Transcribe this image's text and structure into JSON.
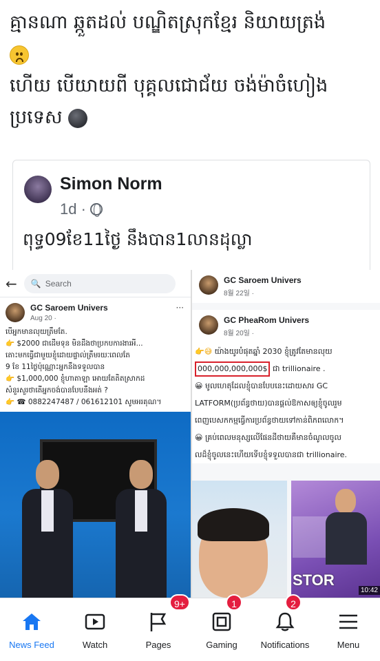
{
  "post": {
    "line1": "គ្មានណា ឆ្កួតដល់ បណ្ឌិតស្រុកខ្មែរ និយាយត្រង់",
    "line1_emoji": "frowning-face",
    "line2": "ហើយ បើយាយពី បុគ្គលជោជ័យ ចង់ម៉ាចំហៀង",
    "line3": "ប្រទេស",
    "line3_emoji": "new-moon-face"
  },
  "shared_post": {
    "author": "Simon Norm",
    "time": "1d ·",
    "text": "ពុទ្ធ09ខែ11ថ្ងៃ នឹងបាន1លានដុល្លា"
  },
  "left_screenshot": {
    "search_placeholder": "Search",
    "page_name": "GC Saroem Univers",
    "date": "Aug 20 ·",
    "menu": "···",
    "lines": [
      "បើអ្នកមានលុយត្រឹមតែ.",
      "$2000 ជាដើមទុន មិនដឹងថាប្រកបការងារអី...",
      "តោះមកធ្វើជាមួយខ្ញុំដោយផ្ទាល់ត្រឹមរយៈពេលតែ",
      "9 ខែ 11ថ្ងៃប៉ុណ្ណោះអ្នកនឹងទទួលបាន",
      "$1,000,000 ខ្ញុំហាតាឡា អោយតែតិតស្រាកដ",
      "សំនួរសួរថាតើអ្នកចង់បានបែបនឹងអត់ ?",
      "0882247487 / 061612101 សូមអរគុណ។"
    ]
  },
  "right_screenshot": {
    "top_page": "GC Saroem Univers",
    "top_date": "8월 22일 ·",
    "page_name": "GC PheaRom Univers",
    "date": "8월 20일 ·",
    "line1": "យ៉ាងយូរបំផុតឆ្នាំ 2030 ខ្ញុំត្រូវតែមានលុយ",
    "amount": "000,000,000,000$",
    "amount_suffix": "ជា trillionaire .",
    "line3": "មូលហេតុដែលខ្ញុំបានបែបនេះដោយសារ GC",
    "line4": "LATFORM(ប្រព័ន្ធថាយ)បានផ្តល់ឱកាសឲ្យខ្ញុំចូលរួម",
    "line5": "ពេញបេសកកម្មធ្វើការប្រព័ន្ធថាយទៅកាន់ពិភពលោក។",
    "line6": "គ្រប់ពេលមនុស្សលើផែនដីថាយគឺមានចំណូលចូល",
    "line7": "លដ៏ខ្ញុំចូលនេះហើយទើបខ្ញុំទទួលបានជា trillionaire.",
    "promo_store": "STOR",
    "promo_time": "10:42"
  },
  "tabbar": {
    "items": [
      {
        "label": "News Feed",
        "icon": "home-icon",
        "badge": ""
      },
      {
        "label": "Watch",
        "icon": "watch-icon",
        "badge": ""
      },
      {
        "label": "Pages",
        "icon": "flag-icon",
        "badge": "9+"
      },
      {
        "label": "Gaming",
        "icon": "gaming-icon",
        "badge": "1"
      },
      {
        "label": "Notifications",
        "icon": "bell-icon",
        "badge": "2"
      },
      {
        "label": "Menu",
        "icon": "menu-icon",
        "badge": ""
      }
    ],
    "active_color": "#1877f2",
    "badge_color": "#e41e3f"
  }
}
